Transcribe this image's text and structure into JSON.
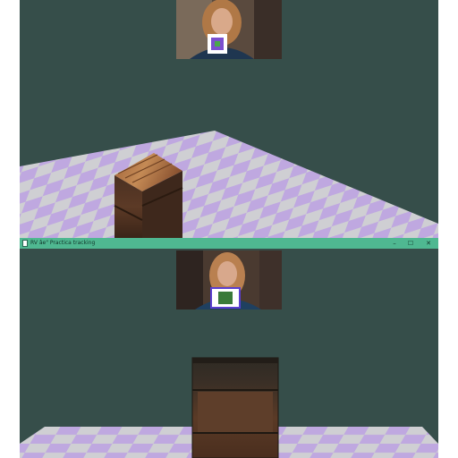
{
  "window": {
    "title": "RV  âe\" Practica tracking",
    "minimize_glyph": "–",
    "maximize_glyph": "☐",
    "close_glyph": "✕"
  },
  "scene": {
    "background_color": "#364e4a",
    "floor_colors": [
      "#cfcfd3",
      "#bfa8e0"
    ],
    "icon": "app-window-icon"
  }
}
